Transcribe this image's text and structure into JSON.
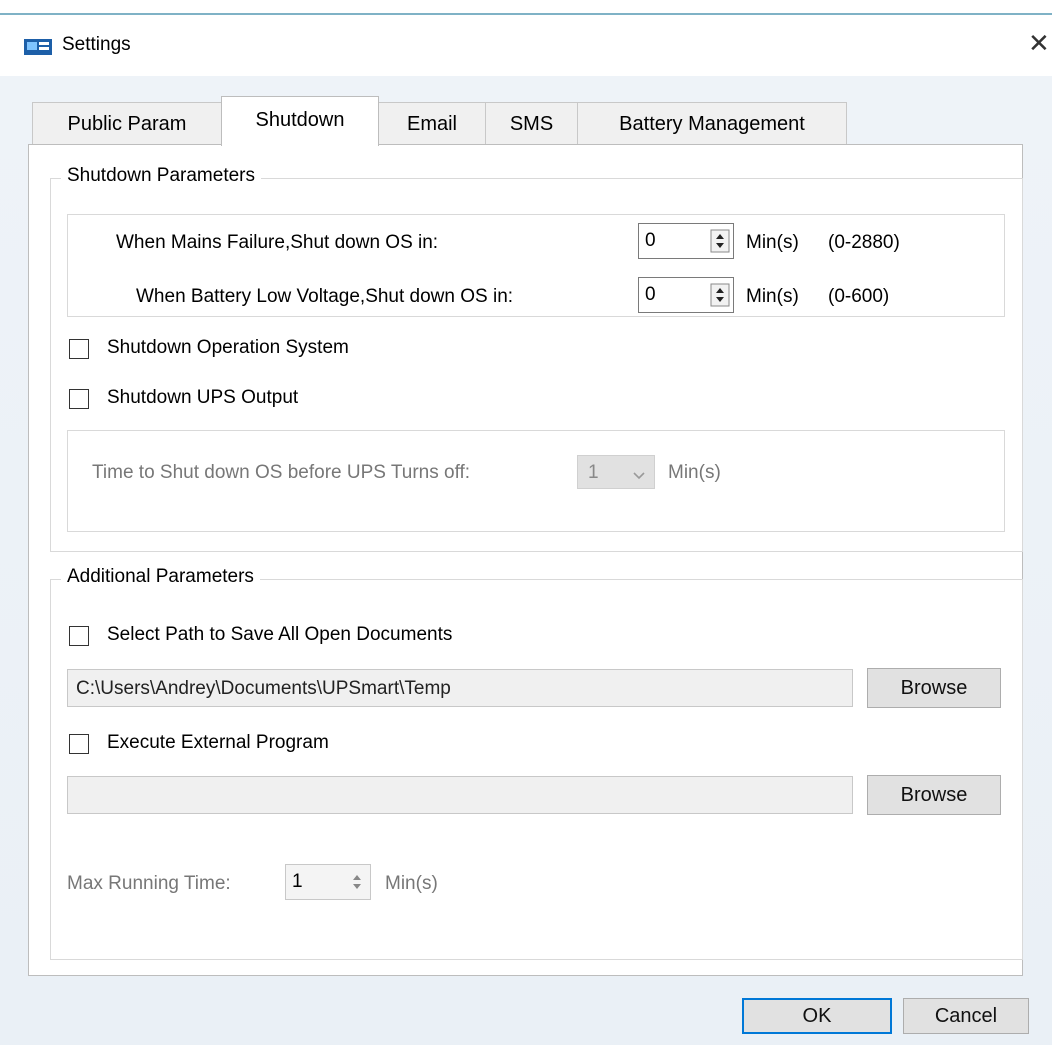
{
  "window": {
    "title": "Settings"
  },
  "tabs": [
    {
      "label": "Public Param",
      "active": false
    },
    {
      "label": "Shutdown",
      "active": true
    },
    {
      "label": "Email",
      "active": false
    },
    {
      "label": "SMS",
      "active": false
    },
    {
      "label": "Battery Management",
      "active": false
    }
  ],
  "shutdown_params": {
    "legend": "Shutdown Parameters",
    "mains_failure": {
      "label": "When Mains Failure,Shut down OS in:",
      "value": "0",
      "unit": "Min(s)",
      "range": "(0-2880)"
    },
    "battery_low": {
      "label": "When Battery Low Voltage,Shut down OS in:",
      "value": "0",
      "unit": "Min(s)",
      "range": "(0-600)"
    },
    "shutdown_os": {
      "label": "Shutdown Operation System",
      "checked": false
    },
    "shutdown_ups": {
      "label": "Shutdown UPS Output",
      "checked": false
    },
    "before_ups": {
      "label": "Time to Shut down OS before UPS Turns off:",
      "value": "1",
      "unit": "Min(s)"
    }
  },
  "additional_params": {
    "legend": "Additional Parameters",
    "save_docs": {
      "label": "Select Path to Save All Open Documents",
      "checked": false,
      "path": "C:\\Users\\Andrey\\Documents\\UPSmart\\Temp",
      "browse": "Browse"
    },
    "external_program": {
      "label": "Execute External Program",
      "checked": false,
      "path": "",
      "browse": "Browse"
    },
    "max_running": {
      "label": "Max Running Time:",
      "value": "1",
      "unit": "Min(s)"
    }
  },
  "footer": {
    "ok": "OK",
    "cancel": "Cancel"
  },
  "colors": {
    "accent": "#0078d7",
    "border": "#d9d9d9",
    "button": "#e1e1e1"
  },
  "icons": [
    "app-icon",
    "close-icon",
    "spin-arrows-icon",
    "dropdown-arrow-icon"
  ]
}
